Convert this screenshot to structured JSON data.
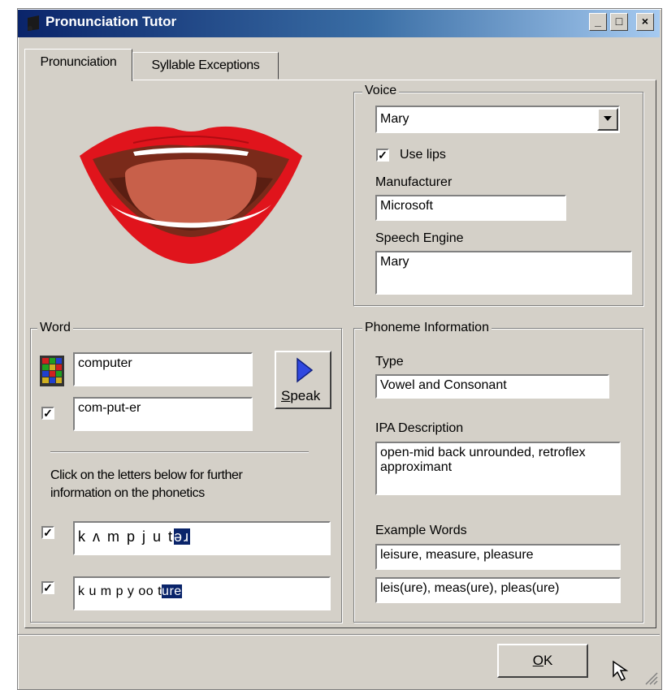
{
  "window": {
    "title": "Pronunciation Tutor",
    "min_label": "_",
    "max_label": "□",
    "close_label": "×"
  },
  "tabs": [
    {
      "label": "Pronunciation"
    },
    {
      "label": "Syllable Exceptions"
    }
  ],
  "voice": {
    "group_label": "Voice",
    "selected": "Mary",
    "use_lips_label": "Use lips",
    "use_lips_checked": "✓",
    "manufacturer_label": "Manufacturer",
    "manufacturer_value": "Microsoft",
    "engine_label": "Speech Engine",
    "engine_value": "Mary"
  },
  "word": {
    "group_label": "Word",
    "word_value": "computer",
    "syllables_value": "com-put-er",
    "syllables_checked": "✓",
    "speak_label_pre": "S",
    "speak_label_rest": "peak",
    "instructions": "Click on the letters below for further information on the phonetics",
    "phonetic_checked": "✓",
    "phonetic_plain": "k ʌ m p j u t",
    "phonetic_selected": "əɹ",
    "spelling_checked": "✓",
    "spelling_plain": "k u m p y oo t",
    "spelling_selected": "ure"
  },
  "phoneme": {
    "group_label": "Phoneme Information",
    "type_label": "Type",
    "type_value": "Vowel and Consonant",
    "ipa_label": "IPA Description",
    "ipa_value": "open-mid back unrounded, retroflex approximant",
    "examples_label": "Example Words",
    "examples_value": "leisure, measure, pleasure",
    "examples_marked": "leis(ure), meas(ure), pleas(ure)"
  },
  "footer": {
    "ok_pre": "O",
    "ok_rest": "K"
  },
  "colors": {
    "lip": "#e0141c",
    "mouth_dark": "#7a2a1a",
    "tongue": "#c8604a",
    "teeth": "#ffffff",
    "selection": "#0a246a"
  }
}
